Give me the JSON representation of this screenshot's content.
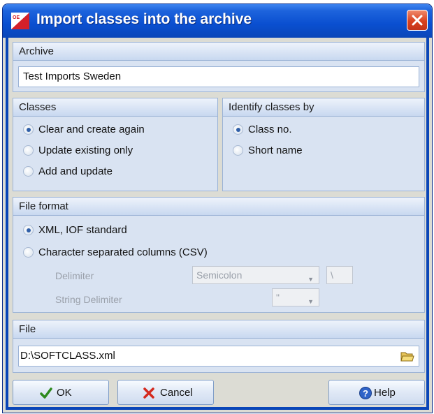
{
  "window": {
    "title": "Import classes into the archive"
  },
  "archive": {
    "header": "Archive",
    "value": "Test Imports Sweden"
  },
  "classes": {
    "header": "Classes",
    "options": [
      {
        "label": "Clear and create again",
        "selected": true
      },
      {
        "label": "Update existing only",
        "selected": false
      },
      {
        "label": "Add and update",
        "selected": false
      }
    ]
  },
  "identify": {
    "header": "Identify classes by",
    "options": [
      {
        "label": "Class no.",
        "selected": true
      },
      {
        "label": "Short name",
        "selected": false
      }
    ]
  },
  "file_format": {
    "header": "File format",
    "options": [
      {
        "label": "XML, IOF standard",
        "selected": true
      },
      {
        "label": "Character separated columns (CSV)",
        "selected": false
      }
    ],
    "delimiter_label": "Delimiter",
    "delimiter_value": "Semicolon",
    "delimiter_char": "\\",
    "string_delimiter_label": "String Delimiter",
    "string_delimiter_value": "\""
  },
  "file": {
    "header": "File",
    "path": "D:\\SOFTCLASS.xml"
  },
  "buttons": {
    "ok": "OK",
    "cancel": "Cancel",
    "help": "Help"
  },
  "colors": {
    "titlebar": "#0a4fd0",
    "group_bg": "#d9e3f2",
    "group_border": "#9bb3d6"
  }
}
